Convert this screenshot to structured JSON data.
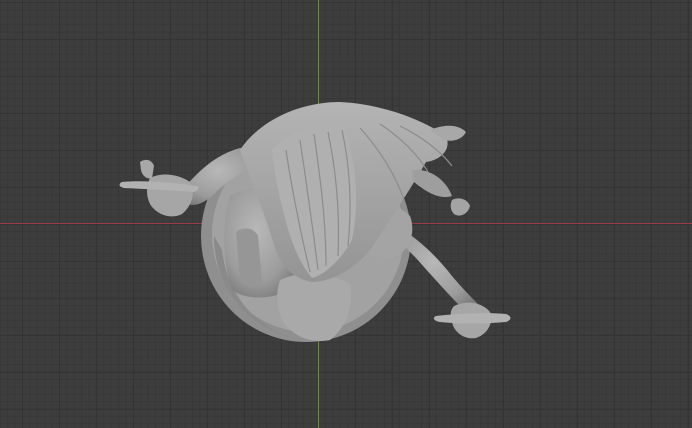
{
  "viewport": {
    "background_color": "#3d3d3d",
    "grid_color": "#343434",
    "x_axis_color": "#9a3a44",
    "y_axis_color": "#6f8e2c",
    "object_color": "#a9a9a9"
  },
  "scene_object": {
    "icon": "sculpted-figure-mesh"
  }
}
